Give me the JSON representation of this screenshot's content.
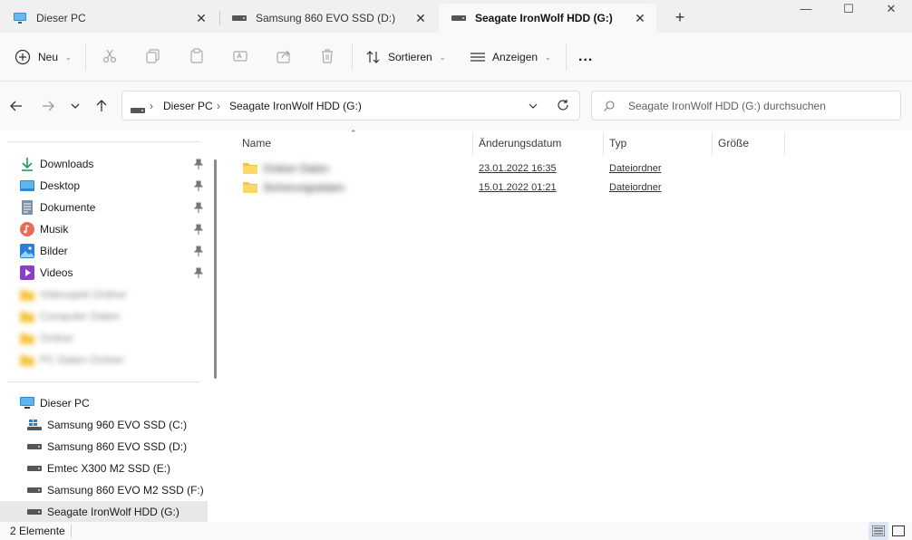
{
  "tabs": [
    {
      "label": "Dieser PC",
      "icon": "monitor-icon"
    },
    {
      "label": "Samsung 860 EVO SSD (D:)",
      "icon": "drive-icon"
    },
    {
      "label": "Seagate IronWolf HDD (G:)",
      "icon": "drive-icon"
    }
  ],
  "toolbar": {
    "new_label": "Neu",
    "sort_label": "Sortieren",
    "view_label": "Anzeigen",
    "more_label": "..."
  },
  "breadcrumb": [
    "Dieser PC",
    "Seagate IronWolf HDD (G:)"
  ],
  "search": {
    "placeholder": "Seagate IronWolf HDD (G:) durchsuchen"
  },
  "sidebar": {
    "quick_access": [
      {
        "label": "Downloads",
        "icon": "download-icon",
        "pinned": true
      },
      {
        "label": "Desktop",
        "icon": "desktop-icon",
        "pinned": true
      },
      {
        "label": "Dokumente",
        "icon": "documents-icon",
        "pinned": true
      },
      {
        "label": "Musik",
        "icon": "music-icon",
        "pinned": true
      },
      {
        "label": "Bilder",
        "icon": "pictures-icon",
        "pinned": true
      },
      {
        "label": "Videos",
        "icon": "videos-icon",
        "pinned": true
      },
      {
        "label": "Videospiel Ordner",
        "icon": "folder-icon",
        "blurred": true
      },
      {
        "label": "Computer Daten",
        "icon": "folder-icon",
        "blurred": true
      },
      {
        "label": "Ordner",
        "icon": "folder-icon",
        "blurred": true
      },
      {
        "label": "PC Daten Ordner",
        "icon": "folder-icon",
        "blurred": true
      }
    ],
    "this_pc": {
      "label": "Dieser PC",
      "icon": "monitor-icon"
    },
    "drives": [
      {
        "label": "Samsung 960 EVO SSD (C:)",
        "icon": "windows-drive-icon"
      },
      {
        "label": "Samsung 860 EVO SSD (D:)",
        "icon": "drive-icon"
      },
      {
        "label": "Emtec X300 M2 SSD (E:)",
        "icon": "drive-icon"
      },
      {
        "label": "Samsung 860 EVO M2 SSD (F:)",
        "icon": "drive-icon"
      },
      {
        "label": "Seagate IronWolf HDD (G:)",
        "icon": "drive-icon",
        "selected": true
      }
    ]
  },
  "file_list": {
    "columns": [
      "Name",
      "Änderungsdatum",
      "Typ",
      "Größe"
    ],
    "rows": [
      {
        "name": "Ordner Daten",
        "date": "23.01.2022 16:35",
        "type": "Dateiordner",
        "size": ""
      },
      {
        "name": "Sicherungsdaten",
        "date": "15.01.2022 01:21",
        "type": "Dateiordner",
        "size": ""
      }
    ]
  },
  "status": {
    "count": "2 Elemente"
  },
  "colors": {
    "accent": "#0067c0",
    "folder": "#f6c342",
    "selected": "#e8e8e8"
  }
}
